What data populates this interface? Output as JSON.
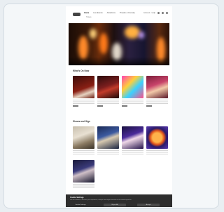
{
  "nav": {
    "links": [
      "Home",
      "Live Events",
      "Attractions",
      "Theatre & Comedy"
    ],
    "sub_label": "Tickets",
    "account_label": "Account · Help"
  },
  "sections": {
    "first_title": "What's On Now",
    "second_title": "Shows and Gigs"
  },
  "colors": {
    "page_bg": "#ffffff",
    "cookie_bg": "#2e2e2e"
  },
  "cookie": {
    "title": "Cookie Settings",
    "body": "We use cookies to enhance your experience, analyse site usage and assist in our marketing efforts.",
    "settings_label": "Cookie Settings",
    "reject_label": "Reject All",
    "accept_label": "Accept"
  }
}
